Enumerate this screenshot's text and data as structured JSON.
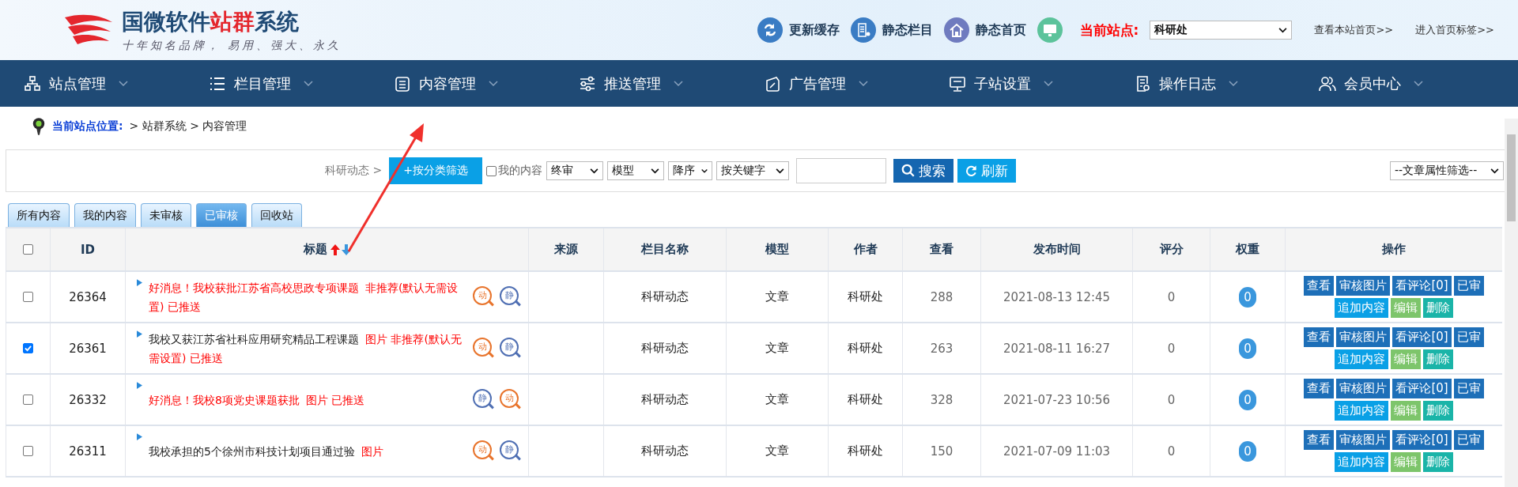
{
  "header": {
    "title_parts": [
      {
        "text": "国微软件",
        "accent": false
      },
      {
        "text": "站群",
        "accent": true
      },
      {
        "text": "系统",
        "accent": false
      }
    ],
    "slogan": "十年知名品牌， 易用、强大、永久",
    "tools": [
      {
        "label": "更新缓存",
        "kind": "refresh"
      },
      {
        "label": "静态栏目",
        "kind": "columns"
      },
      {
        "label": "静态首页",
        "kind": "home"
      },
      {
        "kind": "monitor"
      }
    ],
    "site_label": "当前站点:",
    "site_select": "科研处",
    "links": [
      "查看本站首页>>",
      "进入首页标签>>"
    ]
  },
  "nav": [
    {
      "label": "站点管理",
      "kind": "sitemap"
    },
    {
      "label": "栏目管理",
      "kind": "list"
    },
    {
      "label": "内容管理",
      "kind": "document"
    },
    {
      "label": "推送管理",
      "kind": "sliders"
    },
    {
      "label": "广告管理",
      "kind": "ad"
    },
    {
      "label": "子站设置",
      "kind": "monitor"
    },
    {
      "label": "操作日志",
      "kind": "log"
    },
    {
      "label": "会员中心",
      "kind": "users"
    }
  ],
  "breadcrumb": {
    "label": "当前站点位置:",
    "path": "> 站群系统 > 内容管理"
  },
  "filter": {
    "category": "科研动态 >",
    "category_button": "+按分类筛选",
    "my_content": {
      "label": "我的内容",
      "checked": false
    },
    "selects": [
      "终审",
      "模型",
      "降序",
      "按关键字"
    ],
    "search_button": "搜索",
    "refresh_button": "刷新",
    "attribute_select": "--文章属性筛选--"
  },
  "tabs": [
    {
      "label": "所有内容",
      "selected": false
    },
    {
      "label": "我的内容",
      "selected": false
    },
    {
      "label": "未审核",
      "selected": false
    },
    {
      "label": "已审核",
      "selected": true
    },
    {
      "label": "回收站",
      "selected": false
    }
  ],
  "table": {
    "select_all": {
      "checked": false
    },
    "columns": [
      "ID",
      "标题",
      "来源",
      "栏目名称",
      "模型",
      "作者",
      "查看",
      "发布时间",
      "评分",
      "权重",
      "操作"
    ],
    "rows": [
      {
        "checked": false,
        "id": "26364",
        "title": "好消息！我校获批江苏省高校思政专项课题",
        "title_highlighted": true,
        "tags": "非推荐(默认无需设置) 已推送",
        "previews": [
          {
            "label": "动",
            "kind": "dynamic"
          },
          {
            "label": "静",
            "kind": "static"
          }
        ],
        "category": "科研动态",
        "model": "文章",
        "author": "科研处",
        "views": "288",
        "date": "2021-08-13 12:45",
        "score": "0",
        "weight": "0",
        "actions": [
          {
            "label": "查看",
            "kind": "primary"
          },
          {
            "label": "审核图片",
            "kind": "primary"
          },
          {
            "label": "看评论[0]",
            "kind": "primary"
          },
          {
            "label": "已审",
            "kind": "primary"
          },
          {
            "label": "追加内容",
            "kind": "info"
          },
          {
            "label": "编辑",
            "kind": "success"
          },
          {
            "label": "删除",
            "kind": "teal"
          }
        ]
      },
      {
        "checked": true,
        "id": "26361",
        "title": "我校又获江苏省社科应用研究精品工程课题",
        "title_highlighted": false,
        "tags": "图片 非推荐(默认无需设置) 已推送",
        "previews": [
          {
            "label": "动",
            "kind": "dynamic"
          },
          {
            "label": "静",
            "kind": "static"
          }
        ],
        "category": "科研动态",
        "model": "文章",
        "author": "科研处",
        "views": "263",
        "date": "2021-08-11 16:27",
        "score": "0",
        "weight": "0",
        "actions": [
          {
            "label": "查看",
            "kind": "primary"
          },
          {
            "label": "审核图片",
            "kind": "primary"
          },
          {
            "label": "看评论[0]",
            "kind": "primary"
          },
          {
            "label": "已审",
            "kind": "primary"
          },
          {
            "label": "追加内容",
            "kind": "info"
          },
          {
            "label": "编辑",
            "kind": "success"
          },
          {
            "label": "删除",
            "kind": "teal"
          }
        ]
      },
      {
        "checked": false,
        "id": "26332",
        "title": "好消息！我校8项党史课题获批",
        "title_highlighted": true,
        "tags": "图片 已推送",
        "previews": [
          {
            "label": "静",
            "kind": "static"
          },
          {
            "label": "动",
            "kind": "dynamic"
          }
        ],
        "category": "科研动态",
        "model": "文章",
        "author": "科研处",
        "views": "328",
        "date": "2021-07-23 10:56",
        "score": "0",
        "weight": "0",
        "actions": [
          {
            "label": "查看",
            "kind": "primary"
          },
          {
            "label": "审核图片",
            "kind": "primary"
          },
          {
            "label": "看评论[0]",
            "kind": "primary"
          },
          {
            "label": "已审",
            "kind": "primary"
          },
          {
            "label": "追加内容",
            "kind": "info"
          },
          {
            "label": "编辑",
            "kind": "success"
          },
          {
            "label": "删除",
            "kind": "teal"
          }
        ]
      },
      {
        "checked": false,
        "id": "26311",
        "title": "我校承担的5个徐州市科技计划项目通过验",
        "title_highlighted": false,
        "tags": "图片",
        "previews": [
          {
            "label": "动",
            "kind": "dynamic"
          },
          {
            "label": "静",
            "kind": "static"
          }
        ],
        "category": "科研动态",
        "model": "文章",
        "author": "科研处",
        "views": "150",
        "date": "2021-07-09 11:03",
        "score": "0",
        "weight": "0",
        "actions": [
          {
            "label": "查看",
            "kind": "primary"
          },
          {
            "label": "审核图片",
            "kind": "primary"
          },
          {
            "label": "看评论[0]",
            "kind": "primary"
          },
          {
            "label": "已审",
            "kind": "primary"
          },
          {
            "label": "追加内容",
            "kind": "info"
          },
          {
            "label": "编辑",
            "kind": "success"
          },
          {
            "label": "删除",
            "kind": "teal"
          }
        ]
      }
    ]
  }
}
